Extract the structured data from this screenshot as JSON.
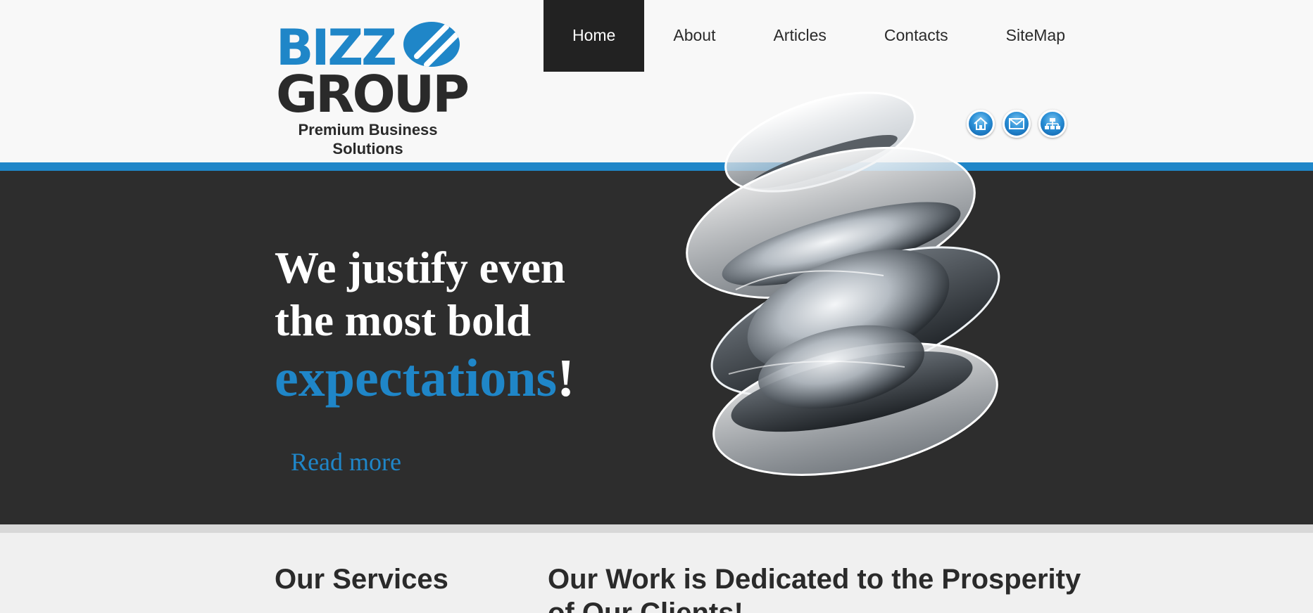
{
  "logo": {
    "line1": "BIZZ",
    "line2": "GROUP",
    "tagline": "Premium Business Solutions"
  },
  "nav": {
    "items": [
      {
        "label": "Home",
        "active": true
      },
      {
        "label": "About",
        "active": false
      },
      {
        "label": "Articles",
        "active": false
      },
      {
        "label": "Contacts",
        "active": false
      },
      {
        "label": "SiteMap",
        "active": false
      }
    ]
  },
  "quick_icons": [
    "home-icon",
    "mail-icon",
    "sitemap-icon"
  ],
  "hero": {
    "line1": "We justify even",
    "line2": "the most bold",
    "line3_accent": "expectations",
    "line3_suffix": "!",
    "read_more": "Read more"
  },
  "content": {
    "left_heading": "Our Services",
    "right_heading": "Our Work is Dedicated to the Prosperity of Our Clients!"
  },
  "colors": {
    "accent": "#1f86c8",
    "dark": "#2d2d2d",
    "nav_active_bg": "#222222",
    "header_bg": "#f8f8f8"
  }
}
